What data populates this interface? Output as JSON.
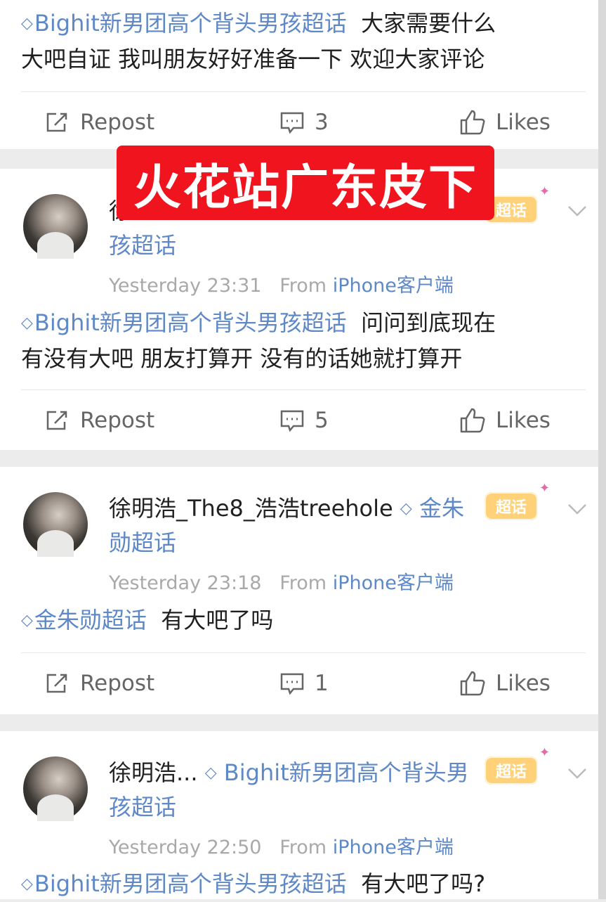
{
  "watermark": "火花站广东皮下",
  "topic_diamond": "◇",
  "actions": {
    "repost_label": "Repost",
    "likes_label": "Likes"
  },
  "posts": [
    {
      "topic": "Bighit新男团高个背头男孩超话",
      "body_line1": "大家需要什么",
      "body_line2": "大吧自证 我叫朋友好好准备一下 欢迎大家评论",
      "comments": "3"
    },
    {
      "username_line1": "徐",
      "username_line2": "孩超话",
      "time": "Yesterday 23:31",
      "from_label": "From",
      "source": "iPhone客户端",
      "badge": "超话",
      "topic": "Bighit新男团高个背头男孩超话",
      "body_line1": "问问到底现在",
      "body_line2": "有没有大吧 朋友打算开 没有的话她就打算开",
      "comments": "5"
    },
    {
      "username": "徐明浩_The8_浩浩treehole",
      "username_topic": "金朱",
      "username_line2": "勋超话",
      "time": "Yesterday 23:18",
      "from_label": "From",
      "source": "iPhone客户端",
      "badge": "超话",
      "topic": "金朱勋超话",
      "body_line1": "有大吧了吗",
      "comments": "1"
    },
    {
      "username": "徐明浩...",
      "username_topic": "Bighit新男团高个背头男",
      "username_line2": "孩超话",
      "time": "Yesterday 22:50",
      "from_label": "From",
      "source": "iPhone客户端",
      "badge": "超话",
      "topic": "Bighit新男团高个背头男孩超话",
      "body_line1": "有大吧了吗?"
    }
  ]
}
